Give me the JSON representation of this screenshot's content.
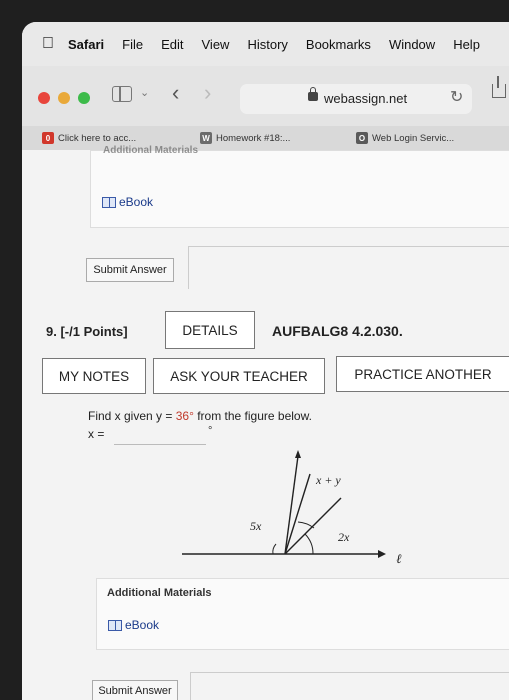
{
  "menubar": {
    "app": "Safari",
    "items": [
      "File",
      "Edit",
      "View",
      "History",
      "Bookmarks",
      "Window",
      "Help"
    ]
  },
  "toolbar": {
    "url": "webassign.net",
    "traffic_colors": [
      "#e8453c",
      "#e9a93a",
      "#3dbb4a"
    ]
  },
  "tabs": [
    {
      "label": "Click here to acc..."
    },
    {
      "label": "Homework #18:..."
    },
    {
      "label": "Web Login Servic..."
    }
  ],
  "prev_question": {
    "partial_header": "Additional Materials",
    "ebook": "eBook",
    "submit": "Submit Answer"
  },
  "question": {
    "number": "9.  [-/1 Points]",
    "details": "DETAILS",
    "code": "AUFBALG8 4.2.030.",
    "my_notes": "MY NOTES",
    "ask_teacher": "ASK YOUR TEACHER",
    "practice_another": "PRACTICE ANOTHER",
    "prompt_start": "Find x given y = ",
    "prompt_value": "36°",
    "prompt_end": " from the figure below.",
    "x_label": "x =",
    "x_value": "",
    "degree_unit": "°",
    "figure": {
      "label_xy": "x + y",
      "label_5x": "5x",
      "label_2x": "2x",
      "label_line": "ℓ"
    },
    "additional_materials": "Additional Materials",
    "ebook": "eBook",
    "submit": "Submit Answer"
  }
}
